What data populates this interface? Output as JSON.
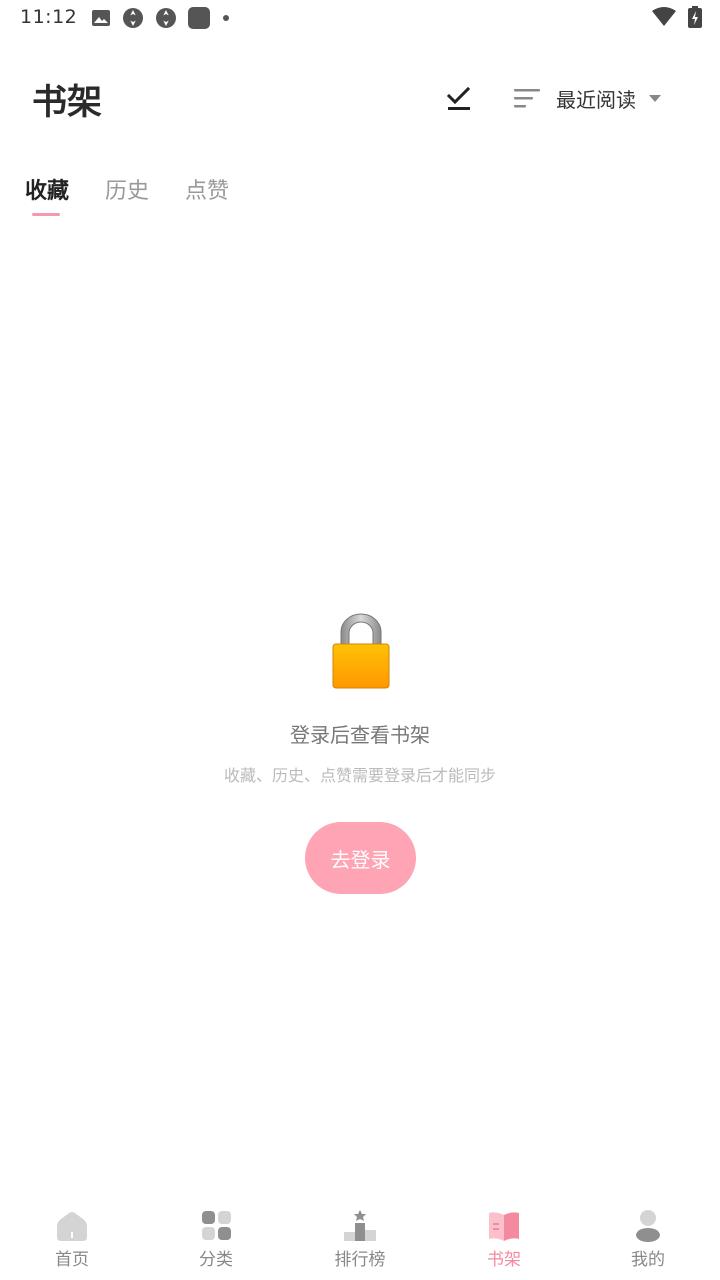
{
  "status_bar": {
    "time": "11:12",
    "notification_icons": [
      "image-icon",
      "app-icon",
      "app-icon",
      "app-square-icon",
      "dot-icon"
    ],
    "right_icons": [
      "wifi-icon",
      "battery-charging-icon"
    ]
  },
  "header": {
    "title": "书架",
    "sort_label": "最近阅读"
  },
  "tabs": [
    {
      "label": "收藏",
      "active": true
    },
    {
      "label": "历史",
      "active": false
    },
    {
      "label": "点赞",
      "active": false
    }
  ],
  "empty_state": {
    "icon": "lock-icon",
    "title": "登录后查看书架",
    "subtitle": "收藏、历史、点赞需要登录后才能同步",
    "button_label": "去登录"
  },
  "bottom_nav": [
    {
      "label": "首页",
      "icon": "home-icon",
      "active": false
    },
    {
      "label": "分类",
      "icon": "category-icon",
      "active": false
    },
    {
      "label": "排行榜",
      "icon": "ranking-icon",
      "active": false
    },
    {
      "label": "书架",
      "icon": "bookshelf-icon",
      "active": true
    },
    {
      "label": "我的",
      "icon": "profile-icon",
      "active": false
    }
  ],
  "colors": {
    "accent": "#f48aa0",
    "button_bg": "#ffa4b4",
    "inactive_icon": "#cccccc"
  }
}
